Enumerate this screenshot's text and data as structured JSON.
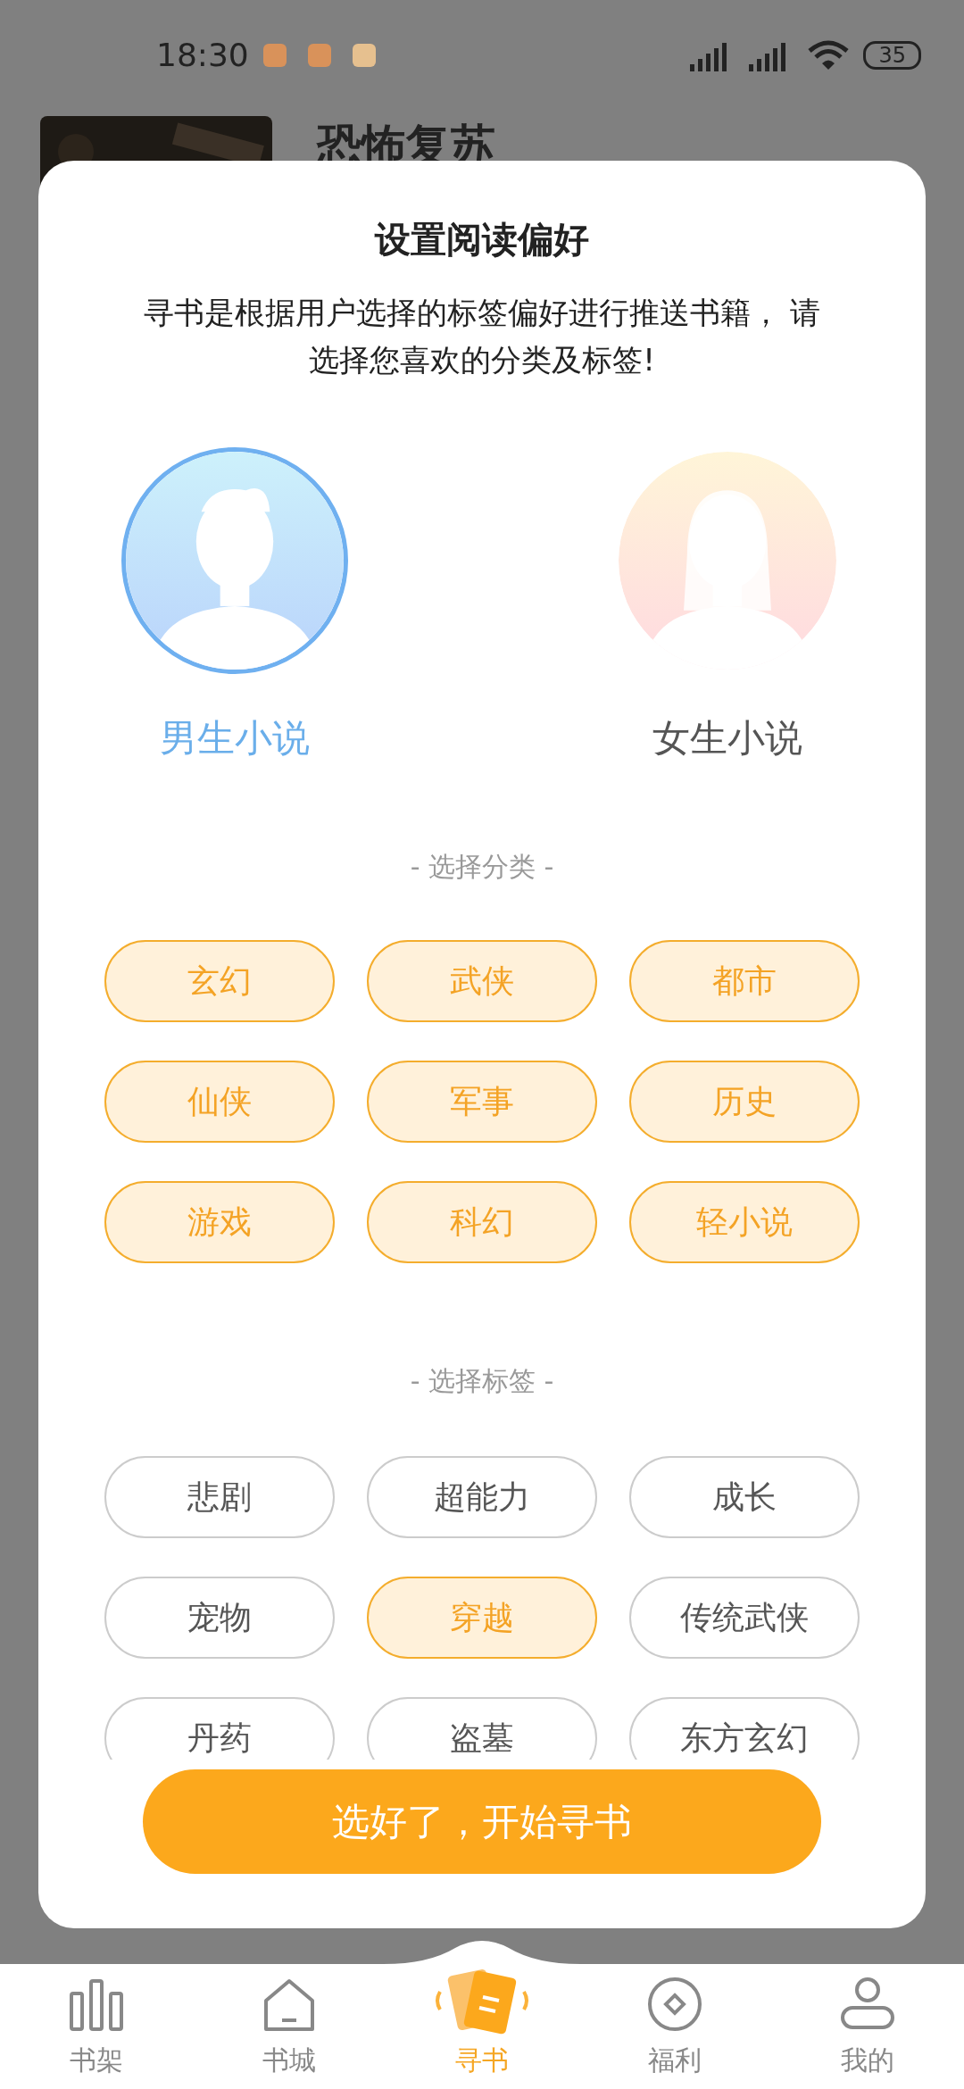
{
  "status_bar": {
    "time": "18:30",
    "battery": "35"
  },
  "background": {
    "book_title": "恐怖复苏"
  },
  "dialog": {
    "title": "设置阅读偏好",
    "description": "寻书是根据用户选择的标签偏好进行推送书籍， 请选择您喜欢的分类及标签!",
    "genders": [
      {
        "kind": "male",
        "label": "男生小说",
        "selected": true
      },
      {
        "kind": "female",
        "label": "女生小说",
        "selected": false
      }
    ],
    "category_heading": "- 选择分类 -",
    "categories": [
      {
        "label": "玄幻",
        "selected": true
      },
      {
        "label": "武侠",
        "selected": true
      },
      {
        "label": "都市",
        "selected": true
      },
      {
        "label": "仙侠",
        "selected": true
      },
      {
        "label": "军事",
        "selected": true
      },
      {
        "label": "历史",
        "selected": true
      },
      {
        "label": "游戏",
        "selected": true
      },
      {
        "label": "科幻",
        "selected": true
      },
      {
        "label": "轻小说",
        "selected": true
      }
    ],
    "tag_heading": "- 选择标签 -",
    "tags": [
      {
        "label": "悲剧",
        "selected": false
      },
      {
        "label": "超能力",
        "selected": false
      },
      {
        "label": "成长",
        "selected": false
      },
      {
        "label": "宠物",
        "selected": false
      },
      {
        "label": "穿越",
        "selected": true
      },
      {
        "label": "传统武侠",
        "selected": false
      },
      {
        "label": "丹药",
        "selected": false
      },
      {
        "label": "盗墓",
        "selected": false
      },
      {
        "label": "东方玄幻",
        "selected": false
      }
    ],
    "confirm_button": "选好了，开始寻书"
  },
  "bottom_nav": [
    {
      "kind": "shelf",
      "label": "书架",
      "selected": false
    },
    {
      "kind": "store",
      "label": "书城",
      "selected": false
    },
    {
      "kind": "find",
      "label": "寻书",
      "selected": true
    },
    {
      "kind": "welfare",
      "label": "福利",
      "selected": false
    },
    {
      "kind": "me",
      "label": "我的",
      "selected": false
    }
  ]
}
